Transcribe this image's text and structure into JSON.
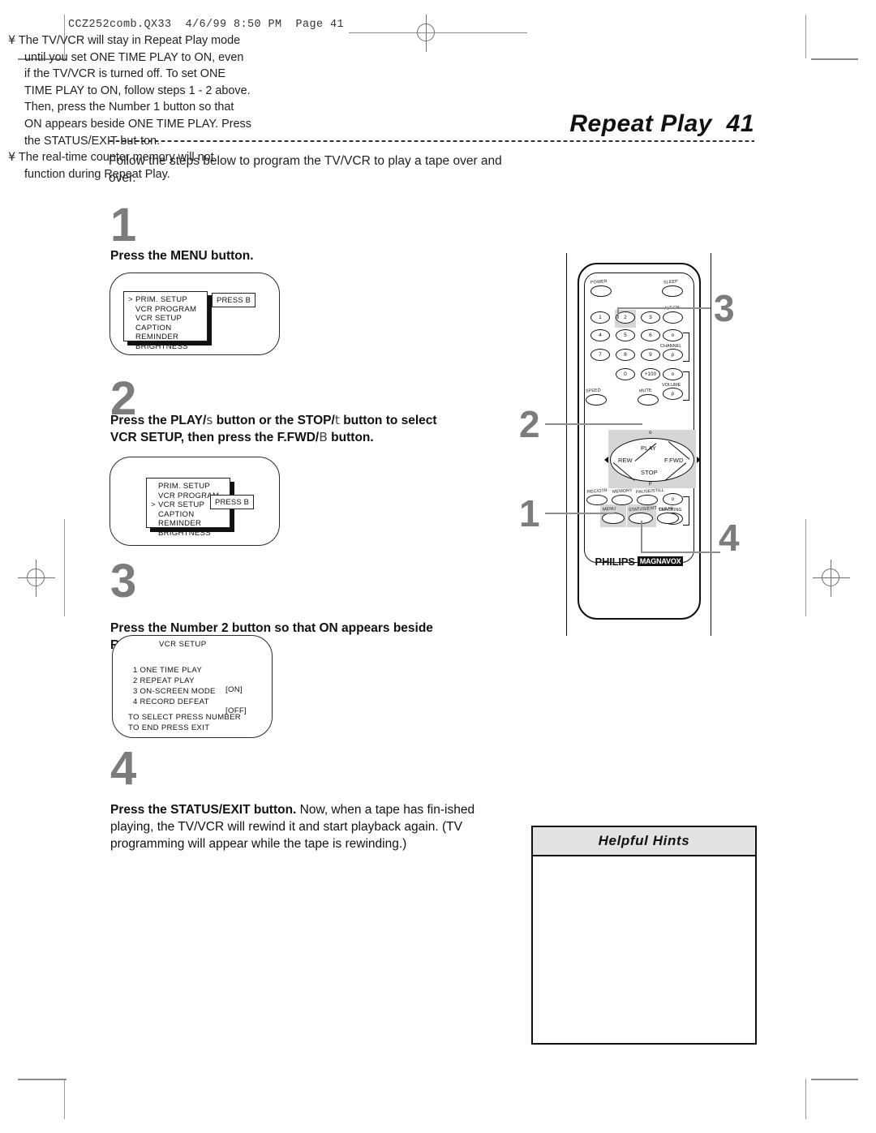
{
  "page": {
    "slug": "CCZ252comb.QX33  4/6/99 8:50 PM  Page 41",
    "title": "Repeat Play  41",
    "intro": "Follow the steps below to program the TV/VCR to play a tape over and over."
  },
  "steps": [
    {
      "number": "1",
      "heading_pre": "Press the MENU button.",
      "heading_post": ""
    },
    {
      "number": "2",
      "heading_line1_a": "Press the PLAY/",
      "heading_line1_sym": "s",
      "heading_line1_b": " button or the STOP/",
      "heading_line1_sym2": "t",
      "heading_line1_c": " button to select",
      "heading_line2_a": "VCR SETUP, then press the F.FWD/",
      "heading_line2_sym": "B",
      "heading_line2_b": " button."
    },
    {
      "number": "3",
      "heading_line1": "Press the Number 2 button so that ON appears beside",
      "heading_line2": "REPEAT PLAY."
    },
    {
      "number": "4",
      "heading_bold": "Press the STATUS/EXIT button.",
      "heading_rest": "  Now, when a tape has fin-ished playing, the TV/VCR will rewind it and start playback again. (TV programming will appear while the tape is rewinding.)"
    }
  ],
  "osd_menu_1": {
    "cursor_index": 0,
    "items": [
      "PRIM. SETUP",
      "VCR PROGRAM",
      "VCR SETUP",
      "CAPTION",
      "REMINDER",
      "BRIGHTNESS"
    ],
    "press_label": "PRESS B"
  },
  "osd_menu_2": {
    "cursor_index": 2,
    "items": [
      "PRIM. SETUP",
      "VCR PROGRAM",
      "VCR SETUP",
      "CAPTION",
      "REMINDER",
      "BRIGHTNESS"
    ],
    "press_label": "PRESS B"
  },
  "osd_setup": {
    "title": "VCR SETUP",
    "rows": [
      {
        "label": "1 ONE TIME PLAY",
        "value": ""
      },
      {
        "label": "2 REPEAT PLAY",
        "value": "[ON]"
      },
      {
        "label": "3 ON-SCREEN MODE",
        "value": ""
      },
      {
        "label": "4 RECORD DEFEAT",
        "value": "[OFF]"
      }
    ],
    "footer1": "TO SELECT PRESS NUMBER",
    "footer2": "TO END PRESS EXIT"
  },
  "remote": {
    "brand_philips": "PHILIPS",
    "brand_magnavox": "MAGNAVOX",
    "labels": {
      "power": "POWER",
      "sleep": "SLEEP",
      "alt_ch": "ALT.CH",
      "channel": "CHANNEL",
      "volume": "VOLUME",
      "speed": "SPEED",
      "mute": "MUTE",
      "rec_otr": "REC/OTR",
      "memory": "MEMORY",
      "pause_still": "PAUSE/STILL",
      "tracking": "TRACKING",
      "menu": "MENU",
      "status_exit": "STATUS/EXIT",
      "clear": "CLEAR",
      "play": "PLAY",
      "stop": "STOP",
      "rew": "REW",
      "ffwd": "F.FWD",
      "up_glyph": "o",
      "down_glyph": "p"
    },
    "keys": [
      "1",
      "2",
      "3",
      "4",
      "5",
      "6",
      "7",
      "8",
      "9",
      "0",
      "+100"
    ]
  },
  "callouts": [
    {
      "id": "callout-3",
      "label": "3"
    },
    {
      "id": "callout-2",
      "label": "2"
    },
    {
      "id": "callout-1",
      "label": "1"
    },
    {
      "id": "callout-4",
      "label": "4"
    }
  ],
  "hints": {
    "title": "Helpful Hints",
    "bullet": "¥",
    "items": [
      "The TV/VCR will stay in Repeat Play mode until you set ONE TIME PLAY to ON, even if the TV/VCR is turned off. To set ONE TIME PLAY to ON, follow steps 1 - 2 above. Then, press the Number 1 button so that ON appears beside ONE TIME PLAY.  Press the STATUS/EXIT but-ton.",
      "The real-time counter memory will not function during Repeat Play."
    ]
  }
}
